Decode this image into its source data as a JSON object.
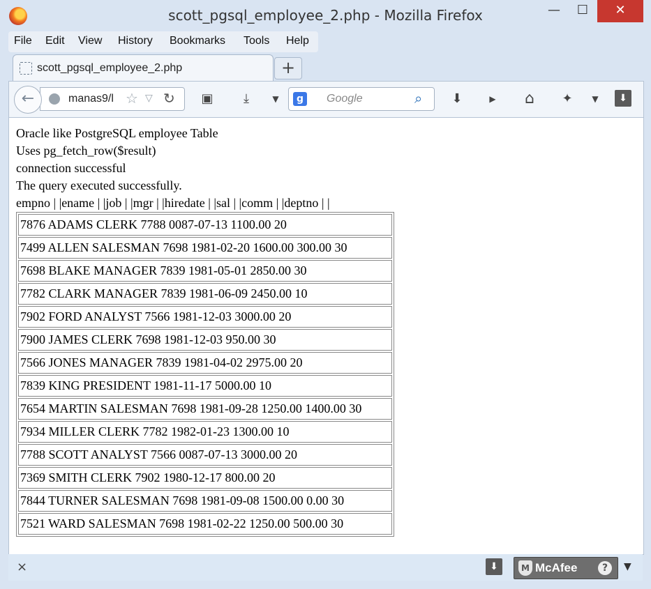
{
  "window": {
    "title": "scott_pgsql_employee_2.php - Mozilla Firefox",
    "minimize": "—",
    "maximize": "☐",
    "close": "✕"
  },
  "menu": {
    "items": [
      "File",
      "Edit",
      "View",
      "History",
      "Bookmarks",
      "Tools",
      "Help"
    ]
  },
  "tab": {
    "label": "scott_pgsql_employee_2.php",
    "newtab": "+"
  },
  "nav": {
    "url": "manas9/l",
    "search_placeholder": "Google",
    "search_engine": "g"
  },
  "page": {
    "lines": [
      "Oracle like PostgreSQL employee Table",
      "Uses pg_fetch_row($result)",
      "connection successful",
      "The query executed successfully.",
      "empno | |ename | |job | |mgr | |hiredate | |sal | |comm | |deptno | |"
    ],
    "rows": [
      "7876 ADAMS CLERK 7788 0087-07-13 1100.00 20",
      "7499 ALLEN SALESMAN 7698 1981-02-20 1600.00 300.00 30",
      "7698 BLAKE MANAGER 7839 1981-05-01 2850.00 30",
      "7782 CLARK MANAGER 7839 1981-06-09 2450.00 10",
      "7902 FORD ANALYST 7566 1981-12-03 3000.00 20",
      "7900 JAMES CLERK 7698 1981-12-03 950.00 30",
      "7566 JONES MANAGER 7839 1981-04-02 2975.00 20",
      "7839 KING PRESIDENT 1981-11-17 5000.00 10",
      "7654 MARTIN SALESMAN 7698 1981-09-28 1250.00 1400.00 30",
      "7934 MILLER CLERK 7782 1982-01-23 1300.00 10",
      "7788 SCOTT ANALYST 7566 0087-07-13 3000.00 20",
      "7369 SMITH CLERK 7902 1980-12-17 800.00 20",
      "7844 TURNER SALESMAN 7698 1981-09-08 1500.00 0.00 30",
      "7521 WARD SALESMAN 7698 1981-02-22 1250.00 500.00 30"
    ]
  },
  "status": {
    "close": "×",
    "mcafee": "McAfee",
    "mcafee_shield": "M",
    "mcafee_help": "?",
    "mcafee_menu": "▼"
  },
  "icons": [
    "firefox-logo",
    "back-arrow",
    "globe",
    "bookmark-star",
    "reload",
    "download-arrow",
    "youtube",
    "home",
    "addon",
    "downloads-panel",
    "shield"
  ]
}
